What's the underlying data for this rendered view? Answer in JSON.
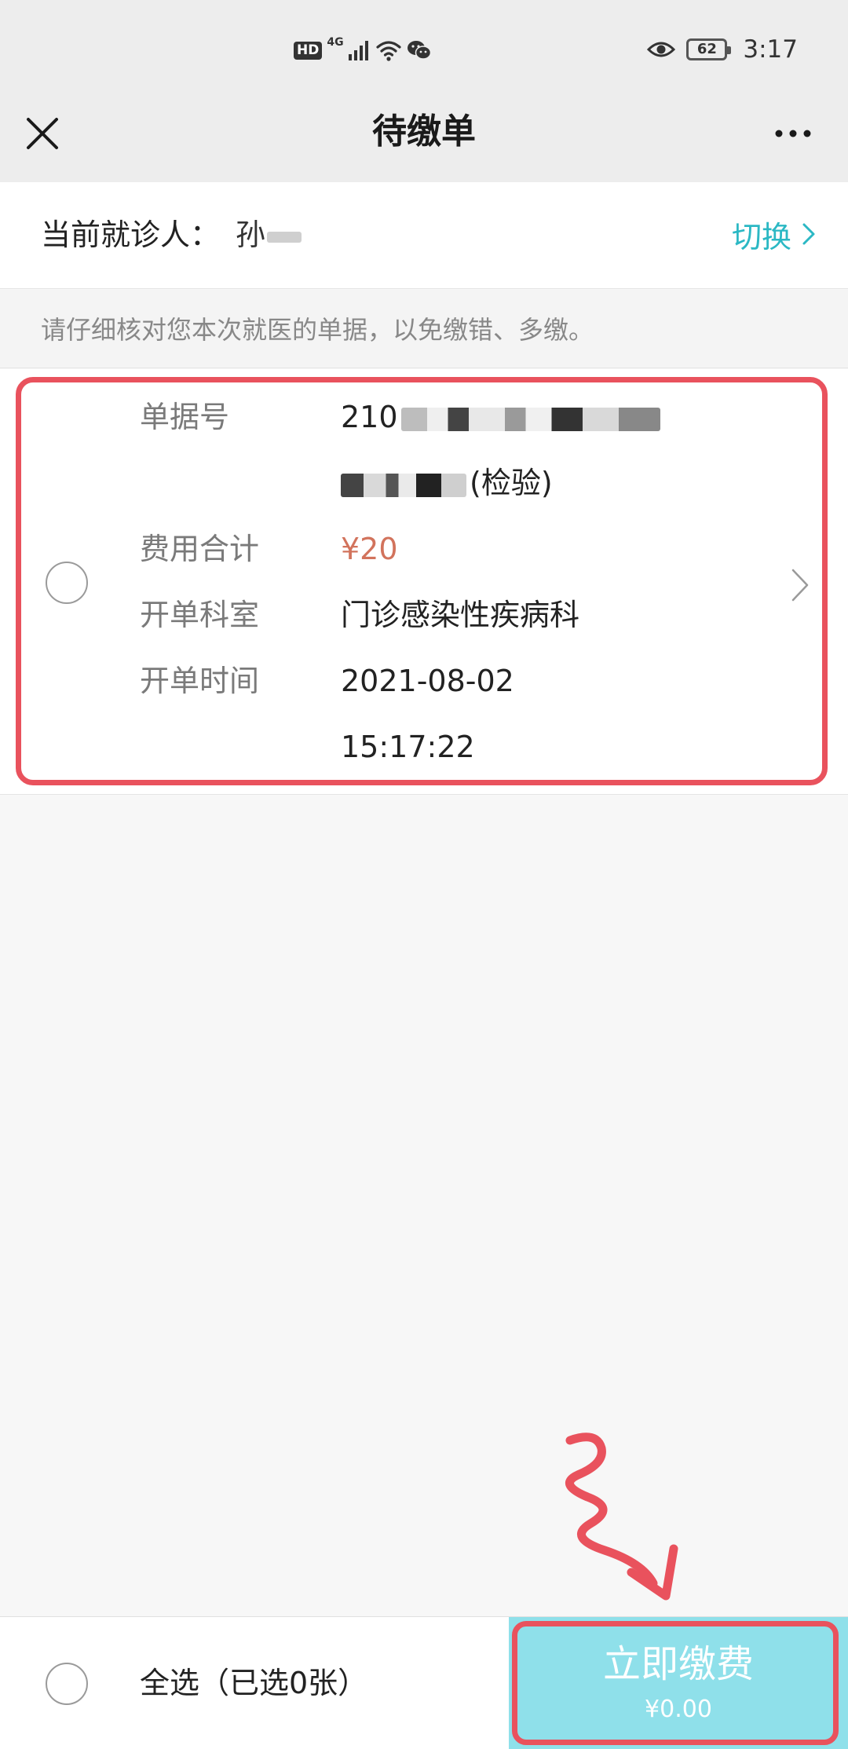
{
  "status_bar": {
    "hd_badge": "HD",
    "network": "4G",
    "battery_level": "62",
    "time": "3:17",
    "icons": [
      "signal-icon",
      "wifi-icon",
      "wechat-icon",
      "eye-icon",
      "battery-icon"
    ]
  },
  "nav": {
    "title": "待缴单",
    "close_icon": "close-icon",
    "more_icon": "more-icon"
  },
  "patient": {
    "label": "当前就诊人：",
    "name_visible": "孙",
    "switch_label": "切换"
  },
  "tip": {
    "text": "请仔细核对您本次就医的单据，以免缴错、多缴。"
  },
  "bill": {
    "fields": [
      {
        "label": "单据号",
        "value_lines": [
          "210",
          "(检验)"
        ]
      },
      {
        "label": "费用合计",
        "value": "¥20"
      },
      {
        "label": "开单科室",
        "value": "门诊感染性疾病科"
      },
      {
        "label": "开单时间",
        "value_lines": [
          "2021-08-02",
          "15:17:22"
        ]
      }
    ],
    "selected": false
  },
  "bottom": {
    "select_all_label": "全选（已选0张）",
    "pay_label": "立即缴费",
    "pay_amount": "¥0.00"
  },
  "colors": {
    "accent": "#2bb8c4",
    "pay_button": "#8fe0ea",
    "price": "#d2735c",
    "annotation": "#e9525d"
  }
}
